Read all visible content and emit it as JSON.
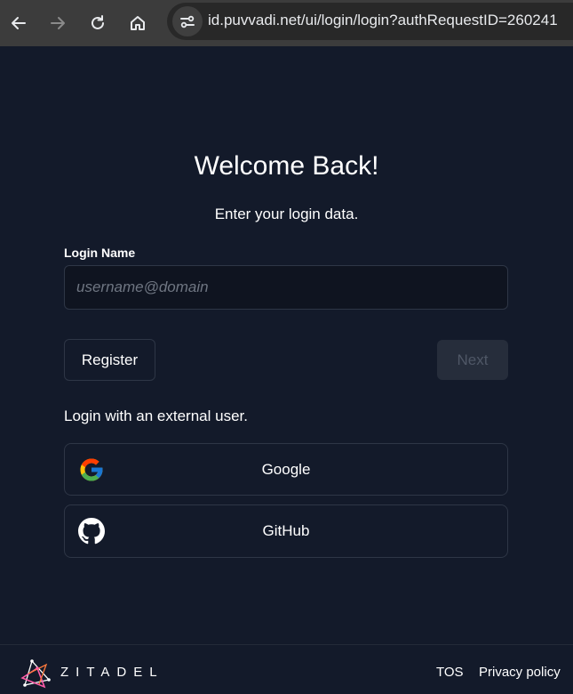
{
  "browser": {
    "url": "id.puvvadi.net/ui/login/login?authRequestID=260241",
    "icons": [
      "back-icon",
      "forward-icon",
      "reload-icon",
      "home-icon",
      "site-info-icon"
    ]
  },
  "login": {
    "title": "Welcome Back!",
    "subtitle": "Enter your login data.",
    "login_name_label": "Login Name",
    "login_name_value": "",
    "login_name_placeholder": "username@domain",
    "register_label": "Register",
    "next_label": "Next",
    "external_label": "Login with an external user.",
    "providers": [
      {
        "label": "Google",
        "icon": "google-icon"
      },
      {
        "label": "GitHub",
        "icon": "github-icon"
      }
    ]
  },
  "footer": {
    "brand": "ZITADEL",
    "tos_label": "TOS",
    "privacy_label": "Privacy policy"
  },
  "colors": {
    "background": "#131a2a",
    "chrome": "#3c3c3c",
    "border": "#2e3646",
    "next_disabled_bg": "#262d3b",
    "next_disabled_text": "#4f5766"
  }
}
